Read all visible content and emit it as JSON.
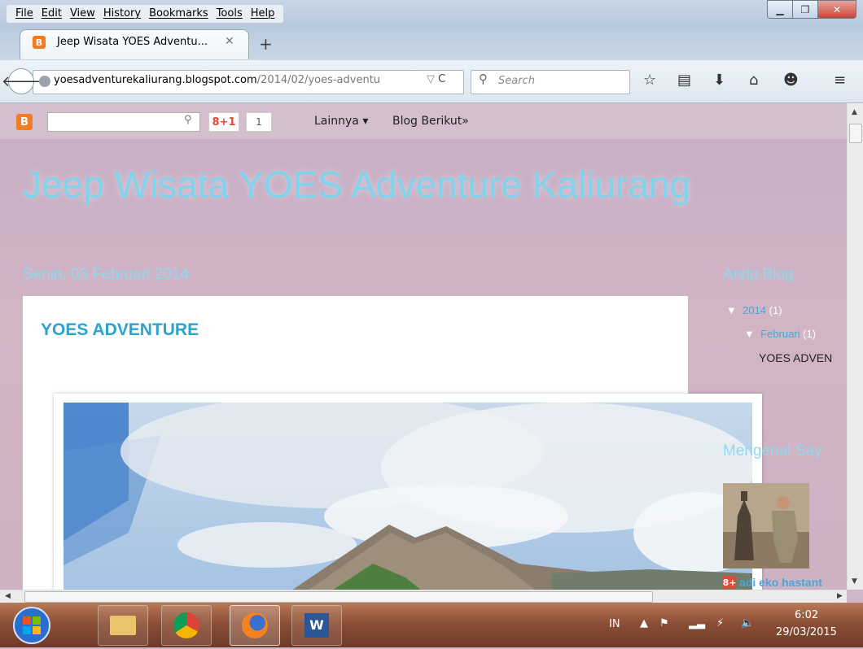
{
  "menu": [
    "File",
    "Edit",
    "View",
    "History",
    "Bookmarks",
    "Tools",
    "Help"
  ],
  "tab": {
    "title": "Jeep Wisata YOES Adventu...",
    "close": "✕",
    "new_tab": "+"
  },
  "navbar": {
    "url_host": "yoesadventurekaliurang.blogspot.com",
    "url_path": "/2014/02/yoes-adventu",
    "search_placeholder": "Search"
  },
  "blogger_bar": {
    "gplus_label": "8+1",
    "gplus_count": "1",
    "more": "Lainnya ▾",
    "next_blog": "Blog Berikut»"
  },
  "blog": {
    "title": "Jeep Wisata YOES Adventure Kaliurang",
    "post_date": "Senin, 03 Februari 2014",
    "post_title": "YOES ADVENTURE"
  },
  "sidebar": {
    "archive_title": "Arsip Blog",
    "year": "2014",
    "year_count": "(1)",
    "month": "Februari",
    "month_count": "(1)",
    "post_link": "YOES ADVEN",
    "profile_title": "Mengenal Say",
    "profile_name": "adi eko hastant"
  },
  "taskbar": {
    "lang": "IN",
    "time": "6:02",
    "date": "29/03/2015"
  },
  "colors": {
    "blog_title": "#7fd3ea",
    "post_title": "#2aa3cf",
    "link": "#4aa7d8"
  }
}
